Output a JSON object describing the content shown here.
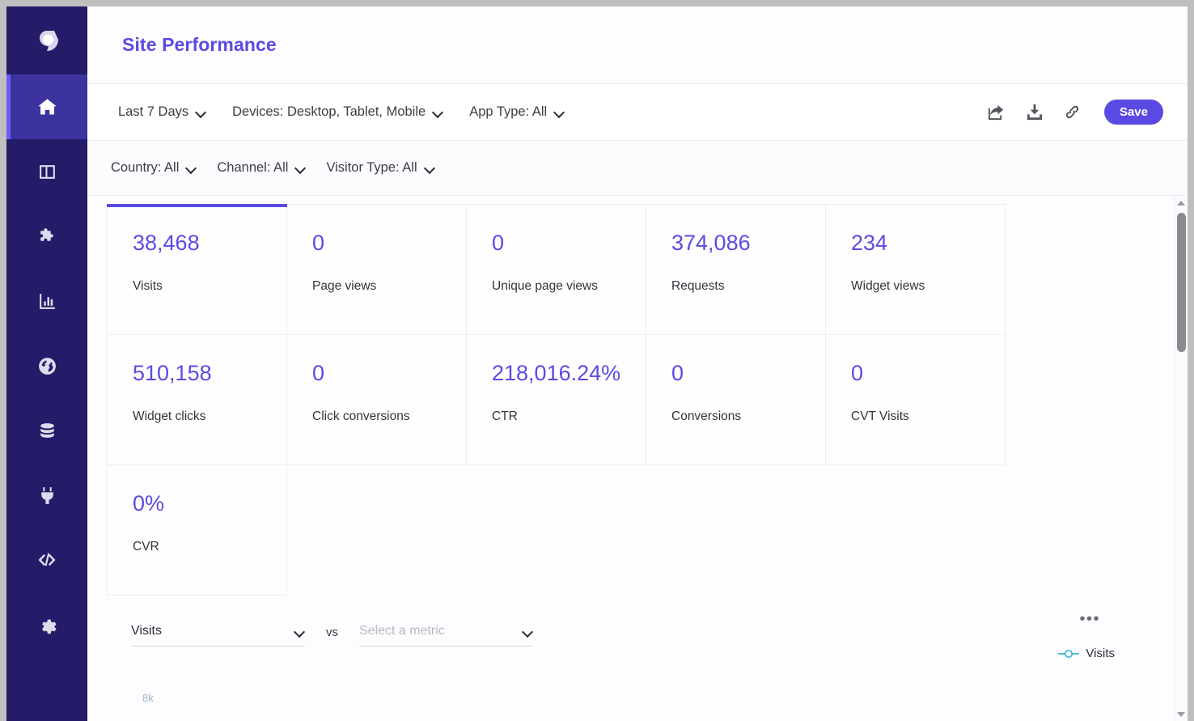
{
  "app": {
    "logo_icon": "brand-logo-icon",
    "title": "Site Performance"
  },
  "colors": {
    "accent": "#5a4ae3",
    "sidebar_bg": "#241c68",
    "sidebar_active": "#3c33a0",
    "legend_series": "#36b8d6",
    "kpi_value": "#5a4ae3"
  },
  "sidebar": {
    "items": [
      {
        "icon": "home-icon",
        "name": "sidebar-item-home",
        "active": true
      },
      {
        "icon": "dashboard-panels-icon",
        "name": "sidebar-item-dashboards",
        "active": false
      },
      {
        "icon": "puzzle-piece-icon",
        "name": "sidebar-item-extensions",
        "active": false
      },
      {
        "icon": "bar-chart-icon",
        "name": "sidebar-item-reports",
        "active": false
      },
      {
        "icon": "globe-icon",
        "name": "sidebar-item-sites",
        "active": false
      },
      {
        "icon": "database-icon",
        "name": "sidebar-item-data",
        "active": false
      },
      {
        "icon": "plug-icon",
        "name": "sidebar-item-integrations",
        "active": false
      },
      {
        "icon": "code-icon",
        "name": "sidebar-item-developers",
        "active": false
      },
      {
        "icon": "gear-icon",
        "name": "sidebar-item-settings",
        "active": false
      }
    ]
  },
  "toolbar": {
    "filters": [
      {
        "label": "Last 7 Days",
        "name": "filter-date-range"
      },
      {
        "label": "Devices: Desktop, Tablet, Mobile",
        "name": "filter-devices"
      },
      {
        "label": "App Type: All",
        "name": "filter-app-type"
      }
    ],
    "actions": [
      {
        "icon": "share-icon",
        "name": "share-button"
      },
      {
        "icon": "download-icon",
        "name": "download-button"
      },
      {
        "icon": "link-icon",
        "name": "copy-link-button"
      }
    ],
    "save_label": "Save"
  },
  "subfilters": {
    "filters": [
      {
        "label": "Country: All",
        "name": "filter-country"
      },
      {
        "label": "Channel: All",
        "name": "filter-channel"
      },
      {
        "label": "Visitor Type: All",
        "name": "filter-visitor-type"
      }
    ]
  },
  "kpis": {
    "row1": [
      {
        "value": "38,468",
        "label": "Visits",
        "selected": true
      },
      {
        "value": "0",
        "label": "Page views",
        "selected": false
      },
      {
        "value": "0",
        "label": "Unique page views",
        "selected": false
      },
      {
        "value": "374,086",
        "label": "Requests",
        "selected": false
      },
      {
        "value": "234",
        "label": "Widget views",
        "selected": false
      }
    ],
    "row2": [
      {
        "value": "510,158",
        "label": "Widget clicks",
        "selected": false
      },
      {
        "value": "0",
        "label": "Click conversions",
        "selected": false
      },
      {
        "value": "218,016.24%",
        "label": "CTR",
        "selected": false
      },
      {
        "value": "0",
        "label": "Conversions",
        "selected": false
      },
      {
        "value": "0",
        "label": "CVT Visits",
        "selected": false
      }
    ],
    "row3": [
      {
        "value": "0%",
        "label": "CVR",
        "selected": false
      }
    ]
  },
  "chart": {
    "primary_metric": "Visits",
    "vs_label": "vs",
    "secondary_metric_placeholder": "Select a metric",
    "secondary_metric_value": "",
    "more_label": "•••",
    "legend": [
      {
        "label": "Visits",
        "color": "#36b8d6"
      }
    ],
    "y_tick_top": "8k"
  },
  "chart_data": {
    "type": "line",
    "title": "",
    "series": [
      {
        "name": "Visits",
        "color": "#36b8d6",
        "values": []
      }
    ],
    "categories": [],
    "xlabel": "",
    "ylabel": "",
    "yticks": [
      "8k"
    ],
    "legend_position": "top-right",
    "grid": false,
    "note": "Chart body is cut off below the visible viewport; only the topmost y-axis tick label is partially rendered."
  },
  "scrollbar": {
    "up_arrow": "scroll-up-arrow-icon",
    "down_arrow": "scroll-down-arrow-icon",
    "thumb": "scroll-thumb"
  }
}
